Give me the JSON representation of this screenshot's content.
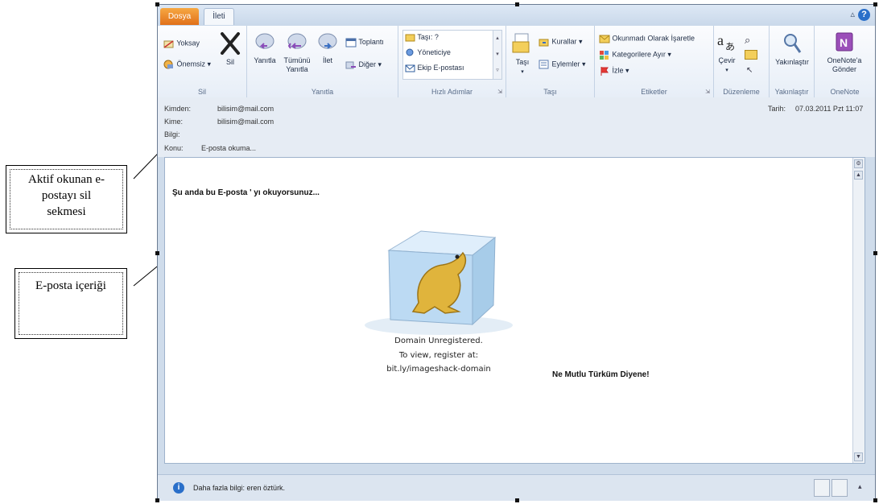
{
  "annotations": {
    "delete_tab": {
      "line1": "Aktif okunan e-",
      "line2": "postayı sil",
      "line3": "sekmesi"
    },
    "content": {
      "label": "E-posta içeriği"
    }
  },
  "tabs": {
    "file": "Dosya",
    "message": "İleti"
  },
  "ribbon": {
    "sil": {
      "label": "Sil",
      "ignore": "Yoksay",
      "junk": "Önemsiz ▾",
      "delete": "Sil"
    },
    "reply": {
      "label": "Yanıtla",
      "reply": "Yanıtla",
      "reply_all_1": "Tümünü",
      "reply_all_2": "Yanıtla",
      "forward": "İlet",
      "meeting": "Toplantı",
      "more": "Diğer ▾"
    },
    "quick_steps": {
      "label": "Hızlı Adımlar",
      "move_to": "Taşı: ?",
      "manager": "Yöneticiye",
      "team_email": "Ekip E-postası"
    },
    "move": {
      "label": "Taşı",
      "move": "Taşı",
      "rules": "Kurallar ▾",
      "actions": "Eylemler ▾"
    },
    "tags": {
      "label": "Etiketler",
      "mark_unread": "Okunmadı Olarak İşaretle",
      "categorize": "Kategorilere Ayır ▾",
      "follow_up": "İzle ▾"
    },
    "editing": {
      "label": "Düzenleme",
      "translate": "Çevir"
    },
    "zoom": {
      "label": "Yakınlaştır",
      "zoom": "Yakınlaştır"
    },
    "onenote": {
      "label": "OneNote",
      "send_1": "OneNote'a",
      "send_2": "Gönder"
    }
  },
  "header": {
    "from_label": "Kimden:",
    "from": "bilisim@mail.com",
    "to_label": "Kime:",
    "to": "bilisim@mail.com",
    "cc_label": "Bilgi:",
    "subject_label": "Konu:",
    "subject": "E-posta okuma...",
    "date_label": "Tarih:",
    "date": "07.03.2011 Pzt 11:07"
  },
  "body": {
    "intro": "Şu anda bu E-posta ' yı okuyorsunuz...",
    "image_text_1": "Domain Unregistered.",
    "image_text_2": "To view, register at:",
    "image_text_3": "bit.ly/imageshack-domain",
    "slogan": "Ne Mutlu Türküm Diyene!"
  },
  "status": {
    "info": "Daha fazla bilgi: eren öztürk."
  },
  "colors": {
    "accent_orange": "#e0701a",
    "info_blue": "#2a6fc9"
  }
}
